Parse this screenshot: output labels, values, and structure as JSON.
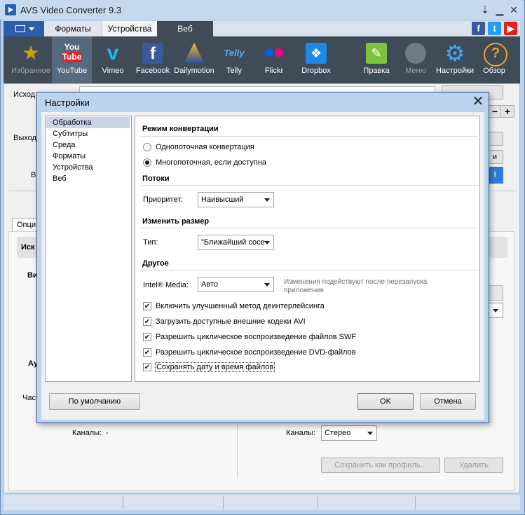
{
  "window": {
    "title": "AVS Video Converter 9.3"
  },
  "tabs": [
    "Форматы",
    "Устройства",
    "Веб"
  ],
  "toolbar": {
    "items": [
      "Избранное",
      "YouTube",
      "Vimeo",
      "Facebook",
      "Dailymotion",
      "Telly",
      "Flickr",
      "Dropbox"
    ],
    "right_items": [
      "Правка",
      "Меню",
      "Настройки",
      "Обзор"
    ],
    "youtube_logo": [
      "You",
      "Tube"
    ],
    "telly_logo": "Telly"
  },
  "background": {
    "input_label": "Исход",
    "output_label": "Выход",
    "row3_label": "В",
    "tab_label": "Опци",
    "header_label": "Иск",
    "video_label": "Ви",
    "audio_label": "Ау",
    "freq_label": "Част",
    "btn_browse": "...",
    "btn_row2_label": "и",
    "btn_convert_label": "!",
    "channels_left_label": "Каналы:",
    "channels_left_value": "-",
    "channels_right_label": "Каналы:",
    "channels_right_value": "Стерео",
    "save_profile": "Сохранить как профиль...",
    "delete": "Удалить"
  },
  "dialog": {
    "title": "Настройки",
    "nav": [
      "Обработка",
      "Субтитры",
      "Среда",
      "Форматы",
      "Устройства",
      "Веб"
    ],
    "sections": {
      "conversion": {
        "title": "Режим конвертации",
        "options": [
          "Однопоточная конвертация",
          "Многопоточная, если доступна"
        ],
        "selected_index": 1
      },
      "threads": {
        "title": "Потоки",
        "priority_label": "Приоритет:",
        "priority_value": "Наивысший"
      },
      "resize": {
        "title": "Изменить размер",
        "type_label": "Тип:",
        "type_value": "\"Ближайший сосе"
      },
      "other": {
        "title": "Другое",
        "intel_label": "Intel® Media:",
        "intel_value": "Авто",
        "note": "Изменения подействуют после перезапуска приложения",
        "checks": [
          {
            "label": "Включить улучшенный метод деинтерлейсинга",
            "checked": true
          },
          {
            "label": "Загрузить доступные внешние кодеки AVI",
            "checked": true
          },
          {
            "label": "Разрешить циклическое воспроизведение файлов SWF",
            "checked": true
          },
          {
            "label": "Разрешить циклическое воспроизведение DVD-файлов",
            "checked": true
          },
          {
            "label": "Сохранять дату и время файлов",
            "checked": true
          }
        ]
      }
    },
    "buttons": {
      "default": "По умолчанию",
      "ok": "OK",
      "cancel": "Отмена"
    }
  }
}
